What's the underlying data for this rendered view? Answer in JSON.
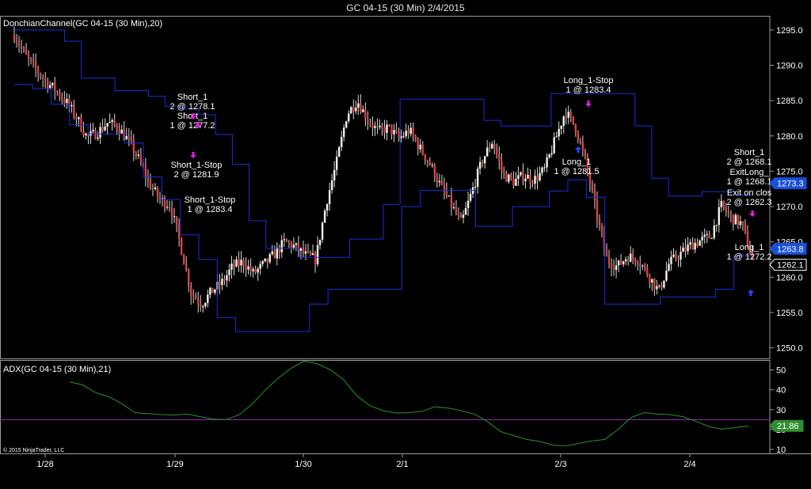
{
  "window": {
    "title": "GC 04-15 (30 Min)  2/4/2015"
  },
  "colors": {
    "background": "#000000",
    "channel": "#1a2fd6",
    "up_candle": "#f2f2e6",
    "down_candle": "#d8433f",
    "wick": "#d8d8d8",
    "adx_line": "#2f8f2f",
    "adx_ref_line": "#9a2fb8",
    "short_arrow": "#e020e0",
    "long_arrow": "#2a45ff",
    "axis": "#9a9a9a",
    "price_tag_blue": "#1a4fd6"
  },
  "price_panel": {
    "indicator_label": "DonchianChannel(GC 04-15 (30 Min),20)",
    "y_ticks": [
      "1295.0",
      "1290.0",
      "1285.0",
      "1280.0",
      "1275.0",
      "1270.0",
      "1265.0",
      "1260.0",
      "1255.0",
      "1250.0"
    ],
    "tags": [
      {
        "text": "1273.3",
        "style": "blue"
      },
      {
        "text": "1263.8",
        "style": "blue"
      },
      {
        "text": "1262.1",
        "style": "white"
      }
    ],
    "trade_labels": [
      {
        "line1": "Short_1",
        "line2": "2 @ 1278.1"
      },
      {
        "line1": "Short_1",
        "line2": "1 @ 1277.2"
      },
      {
        "line1": "Short_1-Stop",
        "line2": "2 @ 1281.9"
      },
      {
        "line1": "Short_1-Stop",
        "line2": "1 @ 1283.4"
      },
      {
        "line1": "Long_1-Stop",
        "line2": "1 @ 1283.4"
      },
      {
        "line1": "Long_1",
        "line2": "1 @ 1281.5"
      },
      {
        "line1": "Short_1",
        "line2": "2 @ 1268.1"
      },
      {
        "line1": "ExitLong_",
        "line2": "1 @ 1268.1"
      },
      {
        "line1": "Exit on clos",
        "line2": "2 @ 1262.3"
      },
      {
        "line1": "Long_1",
        "line2": "1 @ 1272.2"
      }
    ]
  },
  "adx_panel": {
    "indicator_label": "ADX(GC 04-15 (30 Min),21)",
    "y_ticks": [
      "50",
      "40",
      "30",
      "20",
      "10"
    ],
    "current_value": "21.86",
    "copyright": "© 2015 NinjaTrader, LLC"
  },
  "x_axis": {
    "ticks": [
      "1/28",
      "1/29",
      "1/30",
      "2/1",
      "2/3",
      "2/4"
    ]
  },
  "chart_data": [
    {
      "type": "candlestick",
      "title": "GC 04-15 (30 Min)  2/4/2015",
      "series_label": "DonchianChannel(GC 04-15 (30 Min),20)",
      "ylim": [
        1248.5,
        1297
      ],
      "x": [
        "1/28",
        "1/28",
        "1/28",
        "1/28 ",
        "1/29",
        "1/29",
        "1/29",
        "1/29",
        "1/30",
        "1/30",
        "1/30",
        "1/30",
        "2/1",
        "2/1",
        "2/1",
        "2/1",
        "2/2",
        "2/2",
        "2/2",
        "2/2",
        "2/3",
        "2/3",
        "2/3",
        "2/3",
        "2/4",
        "2/4",
        "2/4",
        "2/4"
      ],
      "close_path": [
        1294.3,
        1291.5,
        1289.5,
        1287.8,
        1286.4,
        1284.8,
        1282.6,
        1279.8,
        1280.5,
        1281.9,
        1281.2,
        1279.3,
        1276.6,
        1273.2,
        1271.0,
        1270.2,
        1264.5,
        1257.8,
        1256.2,
        1258.0,
        1259.3,
        1261.5,
        1262.2,
        1260.5,
        1261.8,
        1263.2,
        1265.0,
        1264.3,
        1263.1,
        1262.5,
        1270.5,
        1276.2,
        1283.1,
        1285.0,
        1282.3,
        1280.6,
        1281.2,
        1279.6,
        1280.8,
        1278.3,
        1276.0,
        1272.9,
        1270.3,
        1267.6,
        1272.0,
        1276.5,
        1279.3,
        1274.6,
        1273.5,
        1274.4,
        1273.8,
        1275.2,
        1279.3,
        1283.5,
        1281.2,
        1276.0,
        1269.0,
        1262.5,
        1261.5,
        1263.0,
        1262.5,
        1260.3,
        1258.0,
        1262.0,
        1263.2,
        1264.5,
        1265.2,
        1265.8,
        1270.1,
        1268.4,
        1267.5,
        1262.5
      ],
      "donchian_upper": [
        1295.0,
        1295.0,
        1295.0,
        1293.4,
        1288.2,
        1288.2,
        1286.4,
        1286.4,
        1285.6,
        1284.2,
        1283.8,
        1283.0,
        1280.2,
        1276.0,
        1268.0,
        1264.1,
        1264.1,
        1262.8,
        1262.8,
        1262.8,
        1265.4,
        1265.4,
        1270.3,
        1285.2,
        1285.2,
        1285.2,
        1285.2,
        1285.2,
        1282.2,
        1281.4,
        1281.4,
        1281.4,
        1286.0,
        1286.0,
        1286.0,
        1286.0,
        1286.0,
        1281.4,
        1274.0,
        1271.5,
        1271.5,
        1272.1,
        1272.1,
        1271.6
      ],
      "donchian_lower": [
        1287.3,
        1286.7,
        1284.5,
        1281.6,
        1280.3,
        1280.3,
        1279.0,
        1274.2,
        1271.0,
        1266.0,
        1262.5,
        1254.3,
        1252.3,
        1252.3,
        1252.3,
        1252.3,
        1256.2,
        1258.3,
        1258.3,
        1258.3,
        1258.3,
        1270.0,
        1272.3,
        1272.3,
        1272.3,
        1267.2,
        1267.2,
        1270.0,
        1270.0,
        1272.2,
        1273.8,
        1271.3,
        1256.2,
        1256.2,
        1256.2,
        1257.2,
        1257.2,
        1257.2,
        1258.3,
        1263.0
      ]
    },
    {
      "type": "line",
      "series_label": "ADX(GC 04-15 (30 Min),21)",
      "ylim": [
        8,
        55
      ],
      "reference_line": 25,
      "values": [
        44,
        42.5,
        38.5,
        36.5,
        33,
        28.5,
        28,
        27.5,
        27.3,
        27.8,
        26.5,
        25.3,
        25.0,
        27.5,
        33,
        40,
        46,
        51,
        54.5,
        53,
        50,
        45,
        37,
        32,
        29.5,
        28.3,
        28.5,
        29.2,
        31.5,
        30.8,
        29.5,
        27.8,
        24,
        19,
        17,
        15,
        14,
        12.2,
        11.8,
        13,
        14.3,
        15,
        20,
        26,
        28.5,
        27.8,
        27.5,
        26.5,
        24,
        21.5,
        20.2,
        21.0,
        21.86
      ],
      "current": 21.86
    }
  ]
}
